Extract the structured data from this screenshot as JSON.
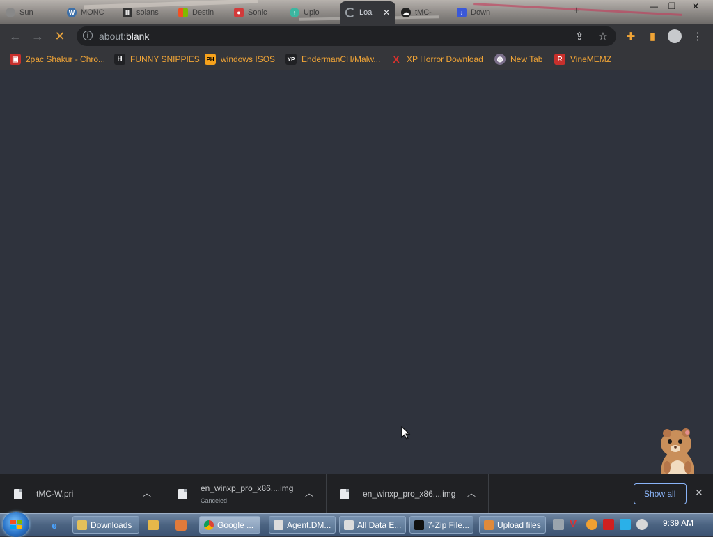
{
  "tabs": [
    {
      "label": "Sun",
      "favicon": "chrome-icon",
      "color": "#888888"
    },
    {
      "label": "MONC",
      "favicon": "wordpress-icon",
      "color": "#3c6fa8"
    },
    {
      "label": "solans",
      "favicon": "bank-icon",
      "color": "#333333"
    },
    {
      "label": "Destin",
      "favicon": "microsoft-icon",
      "color": "#e8a33d"
    },
    {
      "label": "Sonic",
      "favicon": "game-icon",
      "color": "#d23a3a"
    },
    {
      "label": "Uplo",
      "favicon": "upload-icon",
      "color": "#3bb6a0"
    },
    {
      "label": "Loa",
      "favicon": "loading-icon",
      "color": "#9aa0a6"
    },
    {
      "label": "tMC-",
      "favicon": "cloud-icon",
      "color": "#222222"
    },
    {
      "label": "Down",
      "favicon": "download-icon",
      "color": "#3a58d8"
    }
  ],
  "toolbar": {
    "url_prefix": "about:",
    "url_host": "blank"
  },
  "bookmarks": [
    {
      "label": "2pac Shakur - Chro...",
      "icon": "gift-icon",
      "bg": "#c9302c",
      "glyph": "▣"
    },
    {
      "label": "FUNNY SNIPPIES",
      "icon": "h-icon",
      "bg": "#202124",
      "glyph": "H"
    },
    {
      "label": "windows ISOS",
      "icon": "ph-icon",
      "bg": "#f7a21b",
      "glyph": "PH"
    },
    {
      "label": "EndermanCH/Malw...",
      "icon": "yp-icon",
      "bg": "#202124",
      "glyph": "YP"
    },
    {
      "label": "XP Horror Download",
      "icon": "x-icon",
      "bg": "#202124",
      "glyph": "X"
    },
    {
      "label": "New Tab",
      "icon": "globe-icon",
      "bg": "#7b6f8a",
      "glyph": "◍"
    },
    {
      "label": "VineMEMZ",
      "icon": "r-icon",
      "bg": "#c9302c",
      "glyph": "R"
    }
  ],
  "downloads": [
    {
      "name": "tMC-W.pri",
      "status": ""
    },
    {
      "name": "en_winxp_pro_x86....img",
      "status": "Canceled"
    },
    {
      "name": "en_winxp_pro_x86....img",
      "status": ""
    }
  ],
  "downloads_shelf": {
    "show_all": "Show all"
  },
  "taskbar": {
    "buttons": [
      {
        "label": "Downloads",
        "icon": "folder-icon",
        "color": "#e3c05a"
      },
      {
        "label": "Google ...",
        "icon": "chrome-icon",
        "color": "#4caf50"
      },
      {
        "label": "Agent.DM...",
        "icon": "window-icon",
        "color": "#dcdcdc"
      },
      {
        "label": "All Data E...",
        "icon": "window-icon",
        "color": "#dcdcdc"
      },
      {
        "label": "7-Zip File...",
        "icon": "7zip-icon",
        "color": "#111111"
      },
      {
        "label": "Upload files",
        "icon": "upload-icon",
        "color": "#e08a3a"
      }
    ],
    "clock": "9:39 AM"
  },
  "colors": {
    "bookmark_text": "#f0a436",
    "page_bg": "#2f333d",
    "toolbar_bg": "#35363a",
    "downloads_bg": "#202124",
    "accent_blue": "#8ab4f8"
  }
}
